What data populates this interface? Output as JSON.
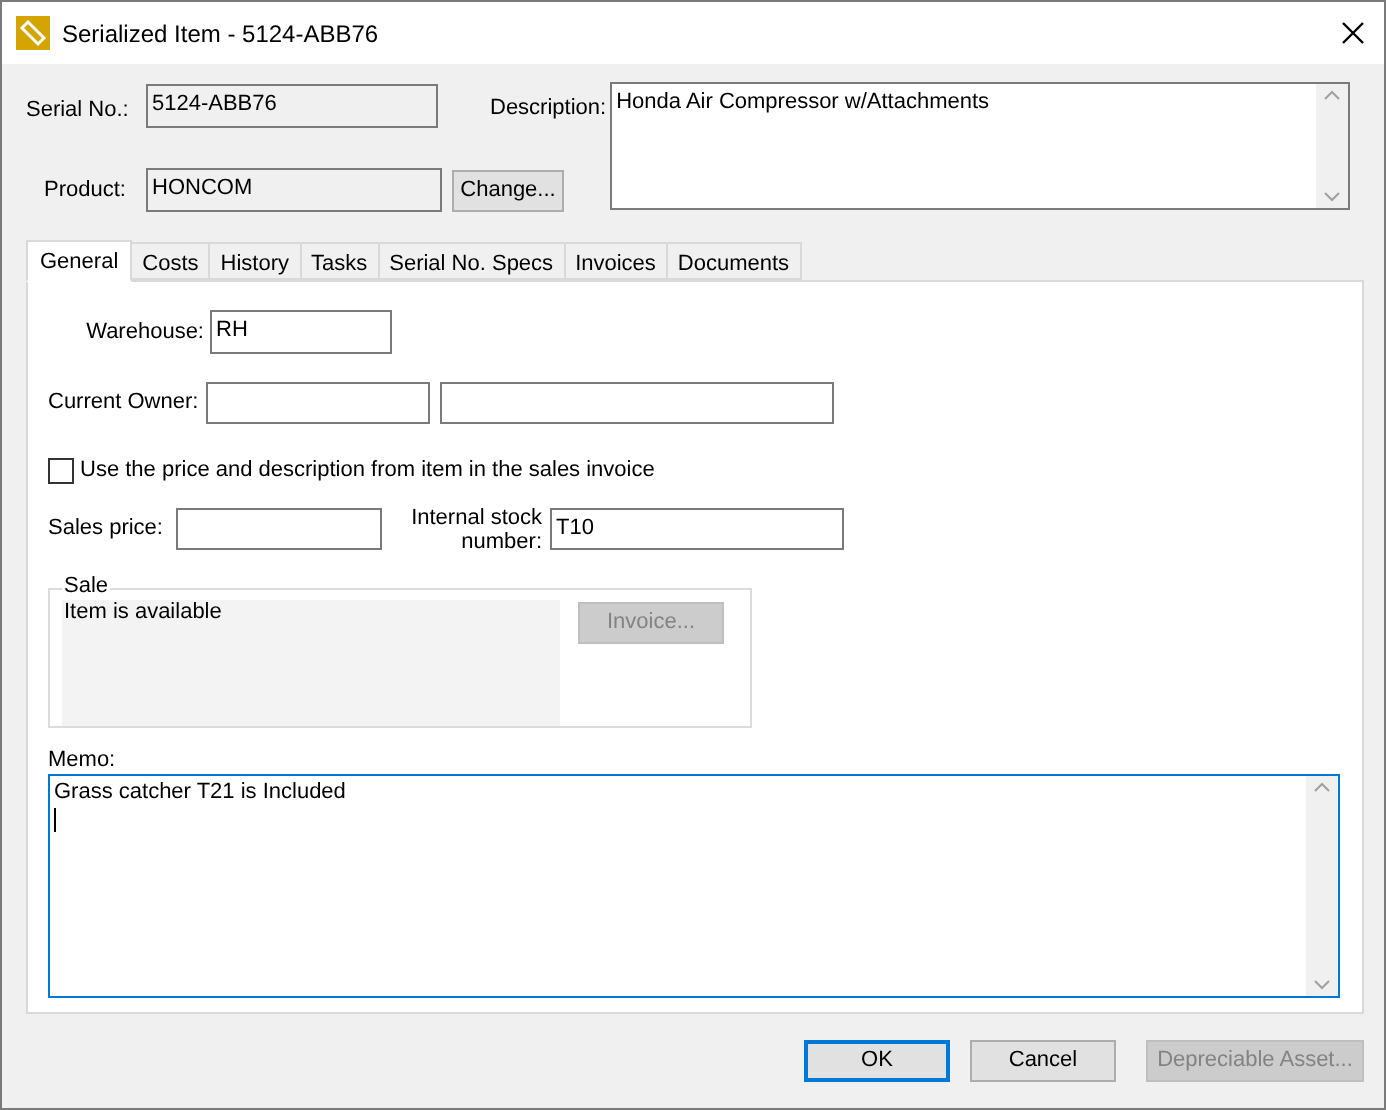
{
  "window": {
    "title": "Serialized Item - 5124-ABB76"
  },
  "serial_no": {
    "label": "Serial No.:",
    "value": "5124-ABB76"
  },
  "description": {
    "label": "Description:",
    "value": "Honda Air Compressor w/Attachments"
  },
  "product": {
    "label": "Product:",
    "value": "HONCOM",
    "button": "Change..."
  },
  "tabs": [
    {
      "label": "General",
      "selected": true
    },
    {
      "label": "Costs",
      "selected": false
    },
    {
      "label": "History",
      "selected": false
    },
    {
      "label": "Tasks",
      "selected": false
    },
    {
      "label": "Serial No. Specs",
      "selected": false
    },
    {
      "label": "Invoices",
      "selected": false
    },
    {
      "label": "Documents",
      "selected": false
    }
  ],
  "general": {
    "warehouse": {
      "label": "Warehouse:",
      "value": "RH"
    },
    "current_owner": {
      "label": "Current Owner:"
    },
    "use_invoice_price": {
      "label": "Use the price and description from item in the sales invoice",
      "checked": false
    },
    "sales_price": {
      "label": "Sales price:"
    },
    "internal_stock_number": {
      "label": "Internal stock number:",
      "value": "T10"
    },
    "sale": {
      "title": "Sale",
      "status": "Item is available",
      "button": {
        "label": "Invoice...",
        "disabled": true
      }
    },
    "memo": {
      "label": "Memo:",
      "value": "Grass catcher T21 is Included"
    }
  },
  "buttons": [
    {
      "label": "OK",
      "default": true,
      "disabled": false
    },
    {
      "label": "Cancel",
      "default": false,
      "disabled": false
    },
    {
      "label": "Depreciable Asset...",
      "default": false,
      "disabled": true
    }
  ]
}
